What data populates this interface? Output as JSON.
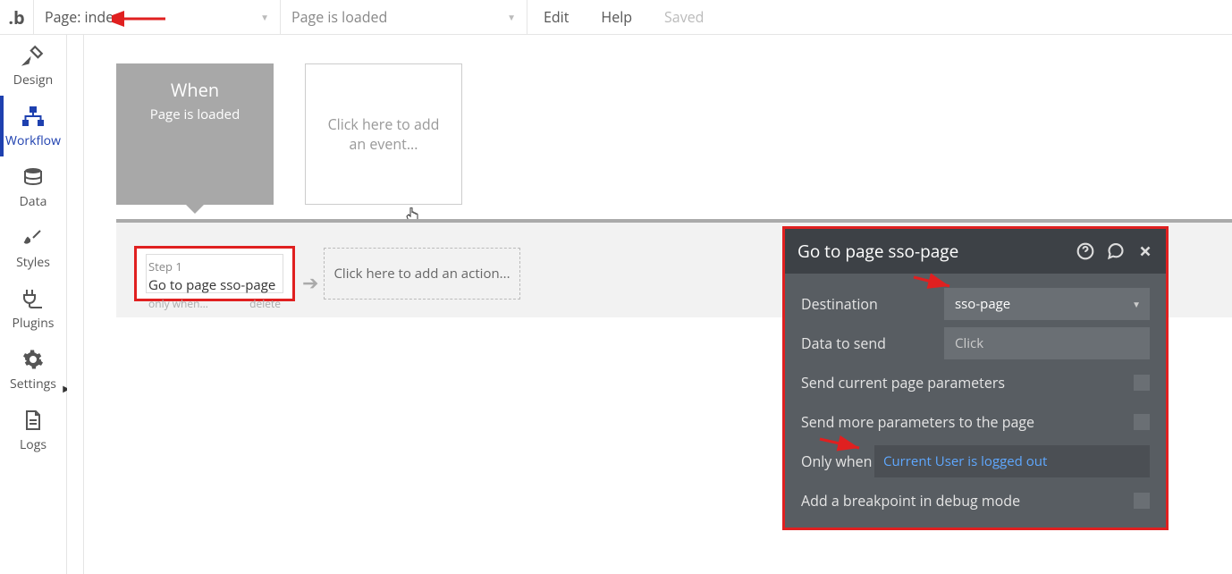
{
  "topbar": {
    "logo": ".b",
    "page_label": "Page: index",
    "event_label": "Page is loaded",
    "edit": "Edit",
    "help": "Help",
    "saved": "Saved"
  },
  "sidebar": {
    "items": [
      {
        "label": "Design"
      },
      {
        "label": "Workflow"
      },
      {
        "label": "Data"
      },
      {
        "label": "Styles"
      },
      {
        "label": "Plugins"
      },
      {
        "label": "Settings"
      },
      {
        "label": "Logs"
      }
    ]
  },
  "events": {
    "selected": {
      "title": "When",
      "subtitle": "Page is loaded"
    },
    "placeholder": "Click here to add an event..."
  },
  "actions": {
    "step1": {
      "step_label": "Step 1",
      "title": "Go to page sso-page",
      "only_when": "only when...",
      "delete": "delete"
    },
    "add_placeholder": "Click here to add an action..."
  },
  "panel": {
    "title": "Go to page sso-page",
    "rows": {
      "destination": {
        "label": "Destination",
        "value": "sso-page"
      },
      "data_to_send": {
        "label": "Data to send",
        "placeholder": "Click"
      },
      "send_current": "Send current page parameters",
      "send_more": "Send more parameters to the page",
      "only_when": {
        "label": "Only when",
        "value": "Current User is logged out"
      },
      "breakpoint": "Add a breakpoint in debug mode"
    }
  }
}
